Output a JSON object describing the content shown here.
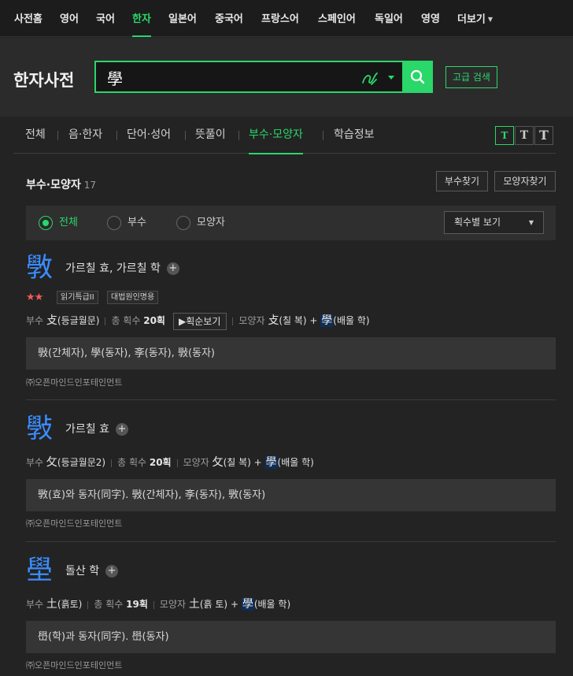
{
  "topnav": {
    "items": [
      "사전홈",
      "영어",
      "국어",
      "한자",
      "일본어",
      "중국어",
      "프랑스어",
      "스페인어",
      "독일어",
      "영영",
      "더보기"
    ],
    "active_index": 3
  },
  "header": {
    "brand": "한자사전",
    "search_value": "學",
    "advanced_search": "고급 검색"
  },
  "subtabs": {
    "items": [
      "전체",
      "음·한자",
      "단어·성어",
      "뜻풀이",
      "부수·모양자",
      "학습정보"
    ],
    "active_index": 4,
    "font_size_buttons": [
      "T",
      "T",
      "T"
    ]
  },
  "section": {
    "title": "부수·모양자",
    "count": "17",
    "find_radical": "부수찾기",
    "find_shape": "모양자찾기"
  },
  "filter": {
    "options": [
      "전체",
      "부수",
      "모양자"
    ],
    "selected_index": 0,
    "sort_label": "획수별 보기"
  },
  "entries": [
    {
      "char": "斆",
      "meaning": "가르칠 효, 가르칠 학",
      "stars": "★★",
      "tags": [
        "읽기특급II",
        "대법원인명용"
      ],
      "radical_label": "부수",
      "radical_char": "攴",
      "radical_desc": "(등글월문)",
      "strokes_label": "총 획수",
      "strokes": "20획",
      "stroke_order_btn": "▶획순보기",
      "shape_label": "모양자",
      "shape_a_char": "攴",
      "shape_a_desc": "(칠 복)",
      "shape_plus": "+",
      "shape_b_char": "學",
      "shape_b_desc": "(배울 학)",
      "info": "斅(간체자), 學(동자), 斈(동자), 斅(동자)",
      "source": "㈜오픈마인드인포테인먼트"
    },
    {
      "char": "斅",
      "meaning": "가르칠 효",
      "radical_label": "부수",
      "radical_char": "攵",
      "radical_desc": "(등글월문2)",
      "strokes_label": "총 획수",
      "strokes": "20획",
      "shape_label": "모양자",
      "shape_a_char": "攵",
      "shape_a_desc": "(칠 복)",
      "shape_plus": "+",
      "shape_b_char": "學",
      "shape_b_desc": "(배울 학)",
      "info": "斆(효)와 동자(同字). 斅(간체자), 斈(동자), 斆(동자)",
      "source": "㈜오픈마인드인포테인먼트"
    },
    {
      "char": "壆",
      "meaning": "돌산 학",
      "radical_label": "부수",
      "radical_char": "土",
      "radical_desc": "(흙토)",
      "strokes_label": "총 획수",
      "strokes": "19획",
      "shape_label": "모양자",
      "shape_a_char": "土",
      "shape_a_desc": "(흙 토)",
      "shape_plus": "+",
      "shape_b_char": "學",
      "shape_b_desc": "(배울 학)",
      "info": "嶨(학)과 동자(同字). 嶨(동자)",
      "source": "㈜오픈마인드인포테인먼트"
    }
  ],
  "colors": {
    "accent": "#2ad769",
    "hanja": "#3a8dff",
    "star": "#f05a5a",
    "background": "#232323"
  }
}
